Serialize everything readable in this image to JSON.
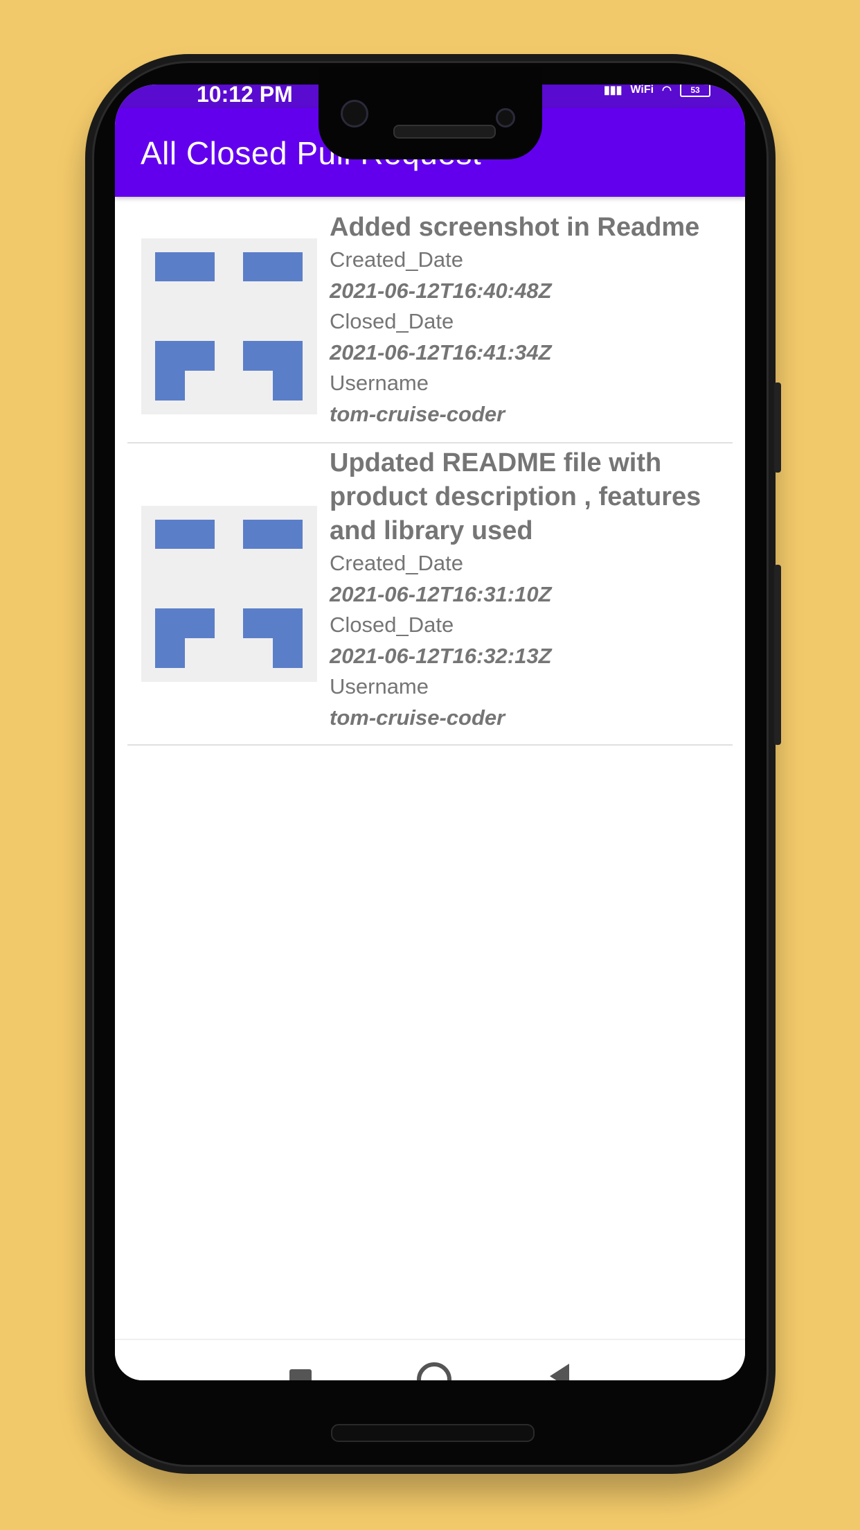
{
  "status_bar": {
    "time": "10:12 PM",
    "wifi_label": "WiFi",
    "battery": "53"
  },
  "app_bar": {
    "title": "All Closed Pull Request"
  },
  "labels": {
    "created": "Created_Date",
    "closed": "Closed_Date",
    "username": "Username"
  },
  "pull_requests": [
    {
      "title": "Added screenshot in Readme",
      "created_date": "2021-06-12T16:40:48Z",
      "closed_date": "2021-06-12T16:41:34Z",
      "username": "tom-cruise-coder"
    },
    {
      "title": "Updated README file with product description , features and library used",
      "created_date": "2021-06-12T16:31:10Z",
      "closed_date": "2021-06-12T16:32:13Z",
      "username": "tom-cruise-coder"
    }
  ],
  "colors": {
    "background": "#f2c96a",
    "primary": "#6200ee",
    "status_bar": "#5a0bd0",
    "placeholder_blue": "#5b7ec8",
    "text_gray": "#757575"
  },
  "icons": [
    "wifi-icon",
    "signal-icon",
    "battery-icon",
    "recents-icon",
    "home-icon",
    "back-icon"
  ]
}
